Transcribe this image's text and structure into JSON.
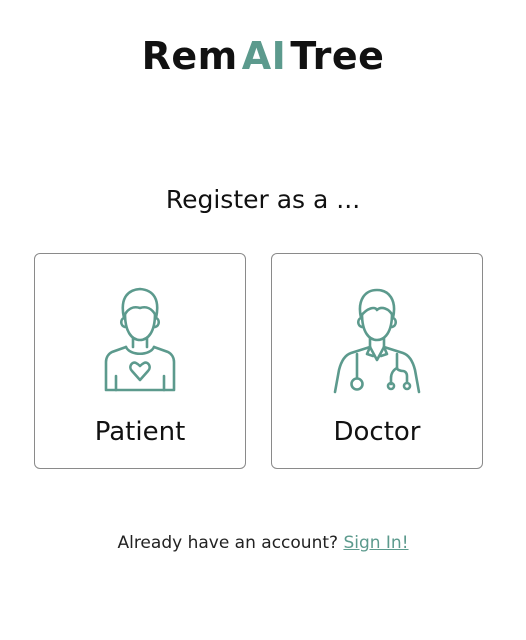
{
  "brand": {
    "name_part1": "Rem",
    "name_part2": "AI",
    "name_part3": "Tree"
  },
  "heading": "Register as a ...",
  "options": [
    {
      "label": "Patient",
      "icon": "patient-icon"
    },
    {
      "label": "Doctor",
      "icon": "doctor-icon"
    }
  ],
  "footer": {
    "prompt": "Already have an account?",
    "link_label": "Sign In!"
  },
  "colors": {
    "accent": "#5c9a8d",
    "text": "#111111",
    "border": "#8a8a8a"
  }
}
